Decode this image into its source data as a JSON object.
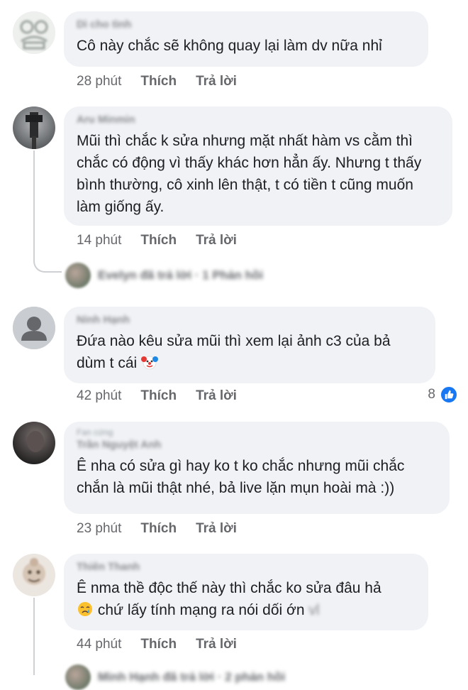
{
  "comments": [
    {
      "author": "Dì cho tình",
      "text": "Cô này chắc sẽ không quay lại làm dv nữa nhỉ",
      "time": "28 phút",
      "like_label": "Thích",
      "reply_label": "Trả lời"
    },
    {
      "author": "Aru Minmin",
      "text": "Mũi thì chắc k sửa nhưng mặt nhất hàm vs cằm thì chắc có động vì thấy khác hơn hẳn ấy. Nhưng t thấy bình thường, cô xinh lên thật, t có tiền t cũng muốn làm giống ấy.",
      "time": "14 phút",
      "like_label": "Thích",
      "reply_label": "Trả lời",
      "replies_summary": "Evelyn đã trả lời · 1 Phản hồi"
    },
    {
      "author": "Ninh Hạnh",
      "text": "Đứa nào kêu sửa mũi thì xem lại ảnh c3 của bả dùm t cái",
      "emoji": "clown-emoji",
      "time": "42 phút",
      "like_label": "Thích",
      "reply_label": "Trả lời",
      "reaction_count": "8",
      "reaction_icon": "like-icon"
    },
    {
      "badge": "Fan cứng",
      "author": "Trần Nguyệt Anh",
      "text": "Ê nha có sửa gì hay ko t ko chắc nhưng mũi chắc chắn là mũi thật nhé, bả live lặn mụn hoài mà :))",
      "time": "23 phút",
      "like_label": "Thích",
      "reply_label": "Trả lời"
    },
    {
      "author": "Thiên Thanh",
      "text_line1": "Ê nma thề độc thế này thì chắc ko sửa đâu hả",
      "emoji": "crying-emoji",
      "text_line2": "chứ lấy tính mạng ra nói dối ớn",
      "text_tail": "vl",
      "time": "44 phút",
      "like_label": "Thích",
      "reply_label": "Trả lời",
      "replies_summary": "Minh Hạnh đã trả lời · 2 phản hồi"
    }
  ],
  "colors": {
    "bubble": "#f0f2f5",
    "meta_text": "#65676b",
    "like_blue": "#1877f2"
  }
}
